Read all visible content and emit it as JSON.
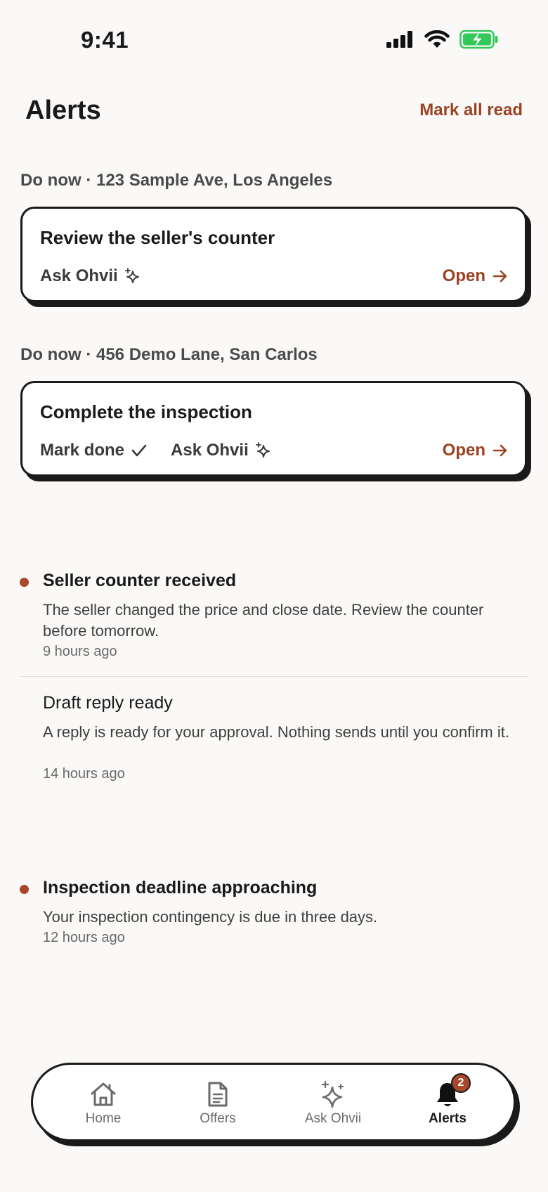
{
  "status_bar": {
    "time": "9:41"
  },
  "header": {
    "title": "Alerts",
    "mark_all_label": "Mark all read"
  },
  "do_now": [
    {
      "section_label": "Do now · 123 Sample Ave, Los Angeles",
      "task_title": "Review the seller's counter",
      "actions": {
        "ask_label": "Ask Ohvii",
        "open_label": "Open"
      }
    },
    {
      "section_label": "Do now · 456 Demo Lane, San Carlos",
      "task_title": "Complete the inspection",
      "actions": {
        "mark_done_label": "Mark done",
        "ask_label": "Ask Ohvii",
        "open_label": "Open"
      }
    }
  ],
  "notifications": [
    {
      "title": "Seller counter received",
      "body": "The seller changed the price and close date. Review the counter before tomorrow.",
      "time": "9 hours ago",
      "unread": true
    },
    {
      "title": "Draft reply ready",
      "body": "A reply is ready for your approval. Nothing sends until you confirm it.",
      "time": "14 hours ago",
      "unread": false
    },
    {
      "title": "Inspection deadline approaching",
      "body": "Your inspection contingency is due in three days.",
      "time": "12 hours ago",
      "unread": true
    }
  ],
  "tab_bar": {
    "tabs": [
      {
        "label": "Home",
        "icon": "home-icon"
      },
      {
        "label": "Offers",
        "icon": "document-icon"
      },
      {
        "label": "Ask Ohvii",
        "icon": "sparkle-icon"
      },
      {
        "label": "Alerts",
        "icon": "bell-icon",
        "active": true
      }
    ],
    "alerts_badge": "2"
  },
  "colors": {
    "accent": "#9a4323",
    "unread_dot": "#a9472a",
    "background": "#faf9f7",
    "battery": "#34c759"
  }
}
